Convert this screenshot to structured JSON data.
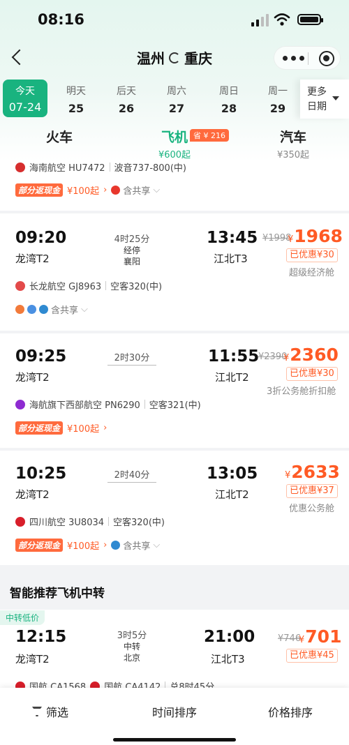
{
  "status": {
    "time": "08:16"
  },
  "nav": {
    "origin": "温州",
    "destination": "重庆"
  },
  "dates": [
    {
      "week": "今天",
      "day": "07-24",
      "active": true
    },
    {
      "week": "明天",
      "day": "25"
    },
    {
      "week": "后天",
      "day": "26"
    },
    {
      "week": "周六",
      "day": "27"
    },
    {
      "week": "周日",
      "day": "28"
    },
    {
      "week": "周一",
      "day": "29"
    }
  ],
  "more_dates": {
    "line1": "更多",
    "line2": "日期"
  },
  "modes": {
    "train": {
      "label": "火车",
      "price": ""
    },
    "flight": {
      "label": "飞机",
      "price": "¥600起",
      "save": "省 ¥ 216"
    },
    "bus": {
      "label": "汽车",
      "price": "¥350起"
    }
  },
  "flights": [
    {
      "partial_airline": "海南航空 HU7472",
      "partial_plane": "波音737-800(中)",
      "cashback": "部分返现金",
      "cashback_from": "¥100起",
      "share": "含共享"
    },
    {
      "dep_time": "09:20",
      "dep_term": "龙湾T2",
      "duration": "4时25分",
      "stop1": "经停",
      "stop2": "襄阳",
      "arr_time": "13:45",
      "arr_term": "江北T3",
      "old_price": "¥1998",
      "price": "1968",
      "discount": "已优惠¥30",
      "cabin": "超级经济舱",
      "airline": "长龙航空 GJ8963",
      "plane": "空客320(中)",
      "share": "含共享"
    },
    {
      "dep_time": "09:25",
      "dep_term": "龙湾T2",
      "duration": "2时30分",
      "arr_time": "11:55",
      "arr_term": "江北T2",
      "old_price": "¥2390",
      "price": "2360",
      "discount": "已优惠¥30",
      "cabin": "3折公务舱折扣舱",
      "airline": "海航旗下西部航空 PN6290",
      "plane": "空客321(中)",
      "cashback": "部分返现金",
      "cashback_from": "¥100起"
    },
    {
      "dep_time": "10:25",
      "dep_term": "龙湾T2",
      "duration": "2时40分",
      "arr_time": "13:05",
      "arr_term": "江北T2",
      "price": "2633",
      "discount": "已优惠¥37",
      "cabin": "优惠公务舱",
      "airline": "四川航空 3U8034",
      "plane": "空客320(中)",
      "cashback": "部分返现金",
      "cashback_from": "¥100起",
      "share": "含共享"
    }
  ],
  "transfer": {
    "title": "智能推荐飞机中转",
    "tag": "中转低价",
    "dep_time": "12:15",
    "dep_term": "龙湾T2",
    "duration": "3时5分",
    "via1": "中转",
    "via2": "北京",
    "arr_time": "21:00",
    "arr_term": "江北T3",
    "old_price": "¥746",
    "price": "701",
    "discount": "已优惠¥45",
    "airline1": "国航 CA1568",
    "airline2": "国航 CA4142",
    "total": "总8时45分"
  },
  "bottom": {
    "filter": "筛选",
    "time_sort": "时间排序",
    "price_sort": "价格排序"
  },
  "currency": "¥",
  "colors": {
    "accent": "#19b37f",
    "price": "#ff5a24",
    "cashback": "#ff6a3d"
  }
}
